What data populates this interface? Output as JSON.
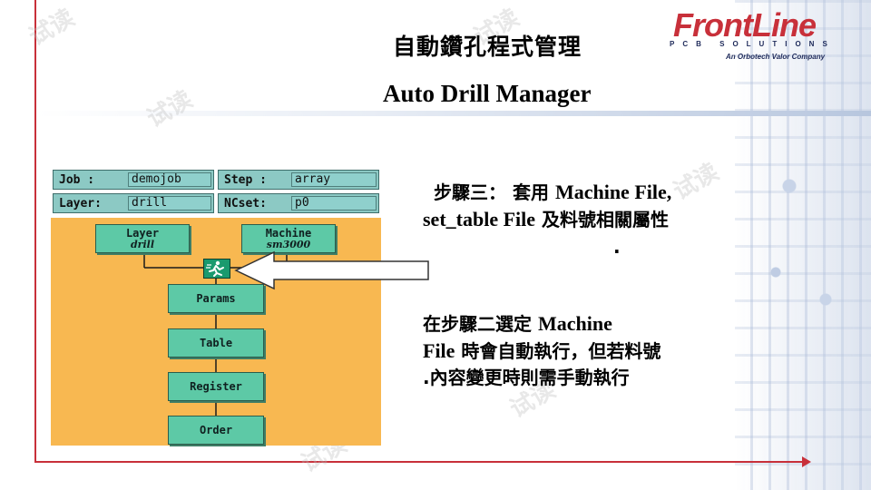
{
  "slide": {
    "title_cn": "自動鑽孔程式管理",
    "title_en": "Auto Drill Manager"
  },
  "logo": {
    "name": "FrontLine",
    "subtitle": "PCB SOLUTIONS",
    "tagline": "An Orbotech Valor Company"
  },
  "watermark": "试读",
  "app": {
    "fields": {
      "job_label": "Job  :",
      "job_value": "demojob",
      "step_label": "Step :",
      "step_value": "array",
      "layer_label": "Layer:",
      "layer_value": "drill",
      "ncset_label": "NCset:",
      "ncset_value": "p0"
    },
    "nodes": {
      "layer_label": "Layer",
      "layer_sub": "drill",
      "machine_label": "Machine",
      "machine_sub": "sm3000",
      "params": "Params",
      "table": "Table",
      "register": "Register",
      "order": "Order"
    }
  },
  "step": {
    "line1_cn": "步驟三：  套用 ",
    "line1_en": "Machine File,",
    "line2_en": "set_table File",
    "line2_cn": " 及料號相關屬性",
    "line3": "."
  },
  "note": {
    "line1_cn": "在步驟二選定  ",
    "line1_en": "Machine",
    "line2_en": "File",
    "line2_cn": "  時會自動執行，但若料號",
    "line3": ".內容變更時則需手動執行"
  },
  "colors": {
    "accent": "#c8303a",
    "panel_bg": "#f8b851",
    "node_fill": "#5dc9a6",
    "field_fill": "#8cc9c4",
    "icon_fill": "#1a9a6e"
  }
}
